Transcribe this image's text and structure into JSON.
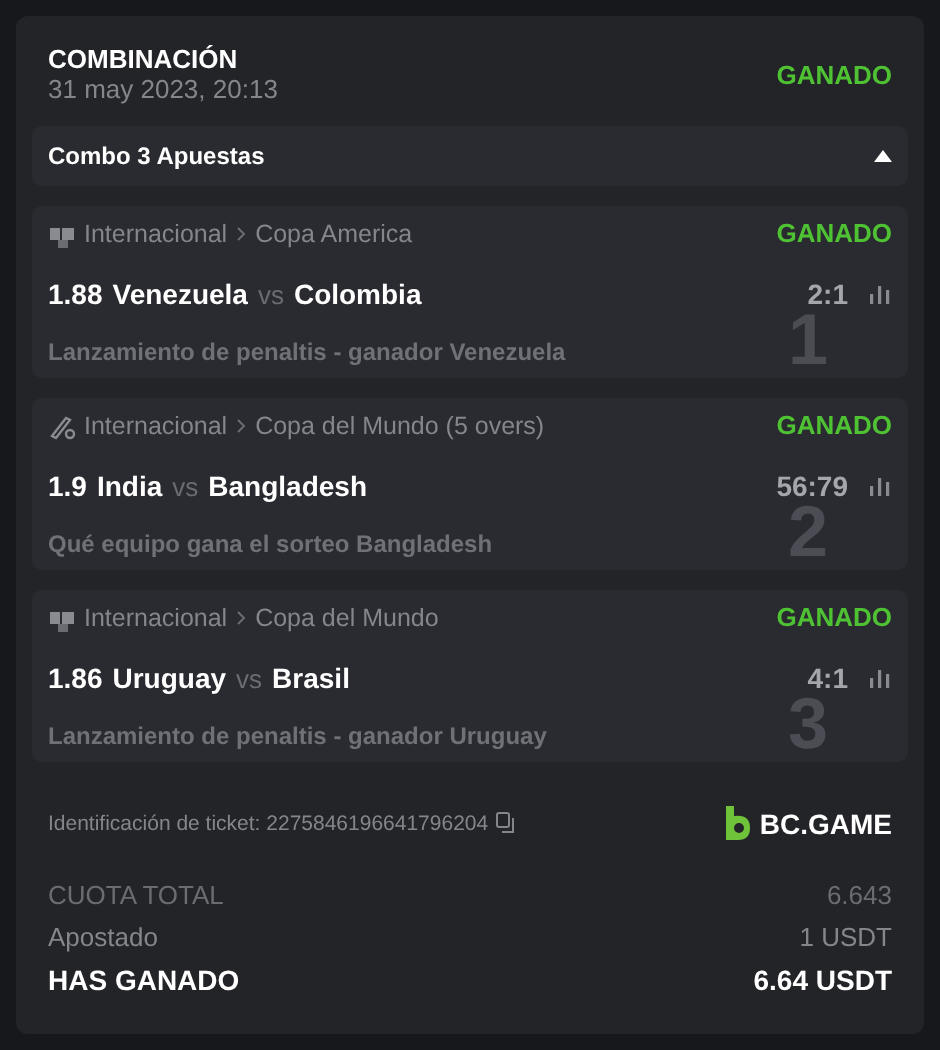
{
  "ticket": {
    "title": "COMBINACIÓN",
    "date": "31 may 2023, 20:13",
    "status": "GANADO"
  },
  "combo": {
    "label": "Combo 3 Apuestas",
    "expanded": true
  },
  "bets": [
    {
      "kind": "penalty",
      "category": "Internacional",
      "league": "Copa America",
      "status": "GANADO",
      "odds": "1.88",
      "home": "Venezuela",
      "vs": "vs",
      "away": "Colombia",
      "score": "2:1",
      "market": "Lanzamiento de penaltis - ganador Venezuela",
      "index": "1"
    },
    {
      "kind": "cricket",
      "category": "Internacional",
      "league": "Copa del Mundo (5 overs)",
      "status": "GANADO",
      "odds": "1.9",
      "home": "India",
      "vs": "vs",
      "away": "Bangladesh",
      "score": "56:79",
      "market": "Qué equipo gana el sorteo Bangladesh",
      "index": "2"
    },
    {
      "kind": "penalty",
      "category": "Internacional",
      "league": "Copa del Mundo",
      "status": "GANADO",
      "odds": "1.86",
      "home": "Uruguay",
      "vs": "vs",
      "away": "Brasil",
      "score": "4:1",
      "market": "Lanzamiento de penaltis - ganador Uruguay",
      "index": "3"
    }
  ],
  "ticket_id": "Identificación de ticket: 2275846196641796204",
  "brand": "BC.GAME",
  "totals": [
    {
      "kind": "muted",
      "label": "CUOTA TOTAL",
      "value": "6.643"
    },
    {
      "kind": "normal",
      "label": "Apostado",
      "value": "1 USDT"
    },
    {
      "kind": "strong",
      "label": "HAS GANADO",
      "value": "6.64 USDT"
    }
  ]
}
